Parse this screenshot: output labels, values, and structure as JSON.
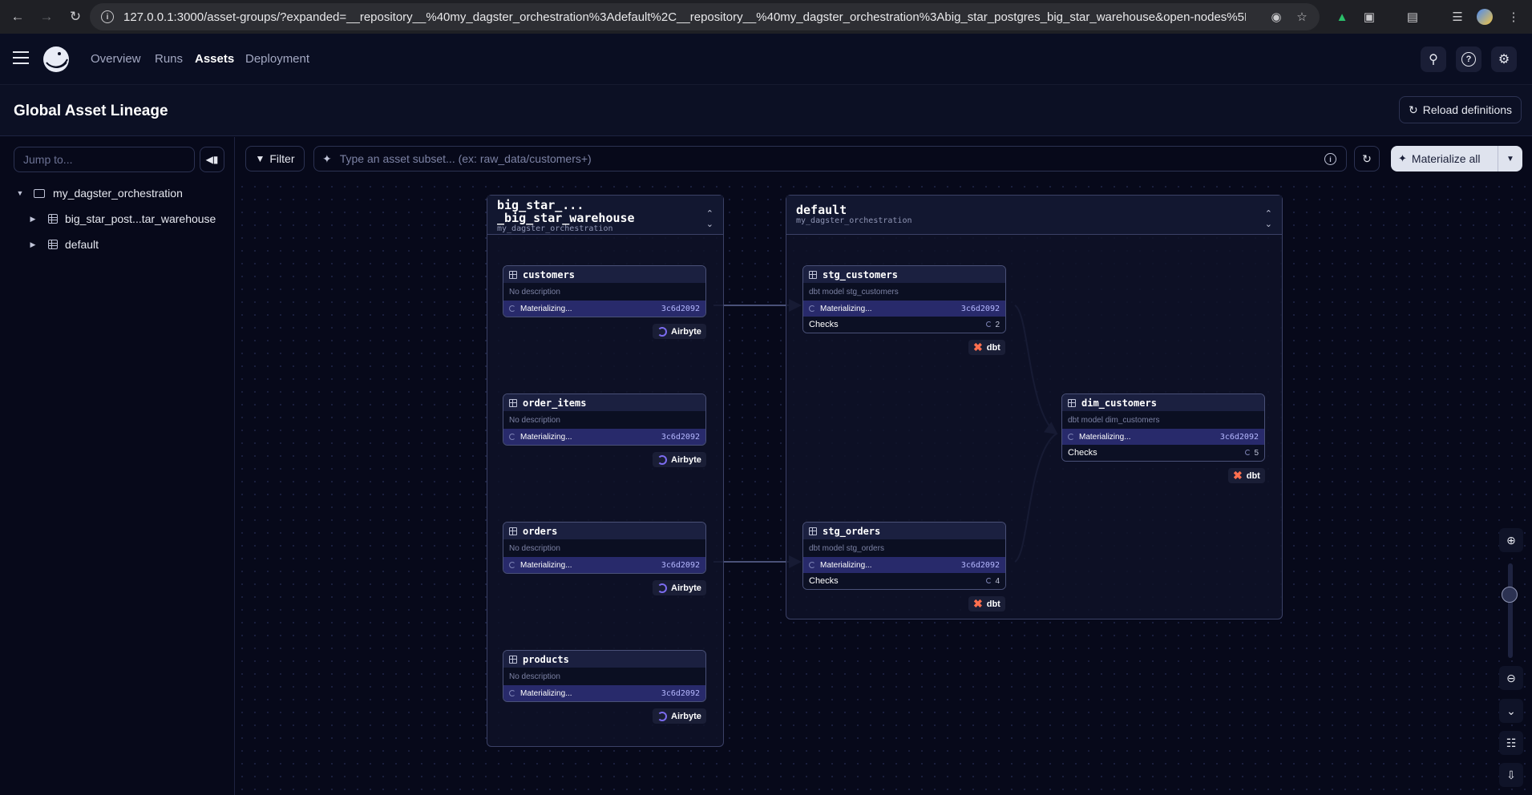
{
  "browser": {
    "url": "127.0.0.1:3000/asset-groups/?expanded=__repository__%40my_dagster_orchestration%3Adefault%2C__repository__%40my_dagster_orchestration%3Abig_star_postgres_big_star_warehouse&open-nodes%5B%5D=my_dagster_orc..."
  },
  "nav": {
    "items": [
      "Overview",
      "Runs",
      "Assets",
      "Deployment"
    ],
    "active": "Assets"
  },
  "page": {
    "title": "Global Asset Lineage",
    "reload_label": "Reload definitions"
  },
  "sidebar": {
    "jump_placeholder": "Jump to...",
    "tree": {
      "root": "my_dagster_orchestration",
      "children": [
        "big_star_post...tar_warehouse",
        "default"
      ]
    }
  },
  "toolbar": {
    "filter_label": "Filter",
    "subset_placeholder": "Type an asset subset... (ex: raw_data/customers+)",
    "materialize_label": "Materialize all"
  },
  "groups": [
    {
      "title": "big_star_...\n_big_star_warehouse",
      "subtitle": "my_dagster_orchestration"
    },
    {
      "title": "default",
      "subtitle": "my_dagster_orchestration"
    }
  ],
  "assets": [
    {
      "name": "customers",
      "description": "No description",
      "status": "Materializing...",
      "hash": "3c6d2092",
      "kind": "Airbyte"
    },
    {
      "name": "order_items",
      "description": "No description",
      "status": "Materializing...",
      "hash": "3c6d2092",
      "kind": "Airbyte"
    },
    {
      "name": "orders",
      "description": "No description",
      "status": "Materializing...",
      "hash": "3c6d2092",
      "kind": "Airbyte"
    },
    {
      "name": "products",
      "description": "No description",
      "status": "Materializing...",
      "hash": "3c6d2092",
      "kind": "Airbyte"
    },
    {
      "name": "stg_customers",
      "description": "dbt model stg_customers",
      "status": "Materializing...",
      "hash": "3c6d2092",
      "checks_label": "Checks",
      "checks_count": "2",
      "kind": "dbt"
    },
    {
      "name": "stg_orders",
      "description": "dbt model stg_orders",
      "status": "Materializing...",
      "hash": "3c6d2092",
      "checks_label": "Checks",
      "checks_count": "4",
      "kind": "dbt"
    },
    {
      "name": "dim_customers",
      "description": "dbt model dim_customers",
      "status": "Materializing...",
      "hash": "3c6d2092",
      "checks_label": "Checks",
      "checks_count": "5",
      "kind": "dbt"
    }
  ],
  "colors": {
    "background": "#07091a",
    "status_bar": "#282a6b",
    "hash": "#b5b8ff",
    "dbt_brand": "#fe6f4f",
    "airbyte_brand": "#7c6cf0"
  }
}
